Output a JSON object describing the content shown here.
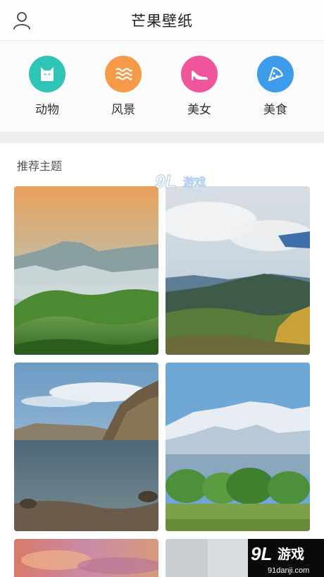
{
  "header": {
    "title": "芒果壁纸",
    "profile_icon": "user-icon"
  },
  "categories": [
    {
      "label": "动物",
      "icon": "cat-face-icon",
      "color": "#2ec4b6"
    },
    {
      "label": "风景",
      "icon": "waves-icon",
      "color": "#f59a48"
    },
    {
      "label": "美女",
      "icon": "high-heel-icon",
      "color": "#f0559b"
    },
    {
      "label": "美食",
      "icon": "pizza-slice-icon",
      "color": "#3d9be9"
    }
  ],
  "section": {
    "title": "推荐主题"
  },
  "wallpapers": [
    {
      "name": "wallpaper-misty-green-hills"
    },
    {
      "name": "wallpaper-mountain-valley-clouds"
    },
    {
      "name": "wallpaper-rocky-coast-sea"
    },
    {
      "name": "wallpaper-snowy-mountains-trees"
    },
    {
      "name": "wallpaper-sunset-clouds"
    },
    {
      "name": "wallpaper-hazy-sky"
    }
  ],
  "watermark": {
    "logo_text": "9L",
    "brand": "游戏",
    "domain": "91danji.com"
  }
}
